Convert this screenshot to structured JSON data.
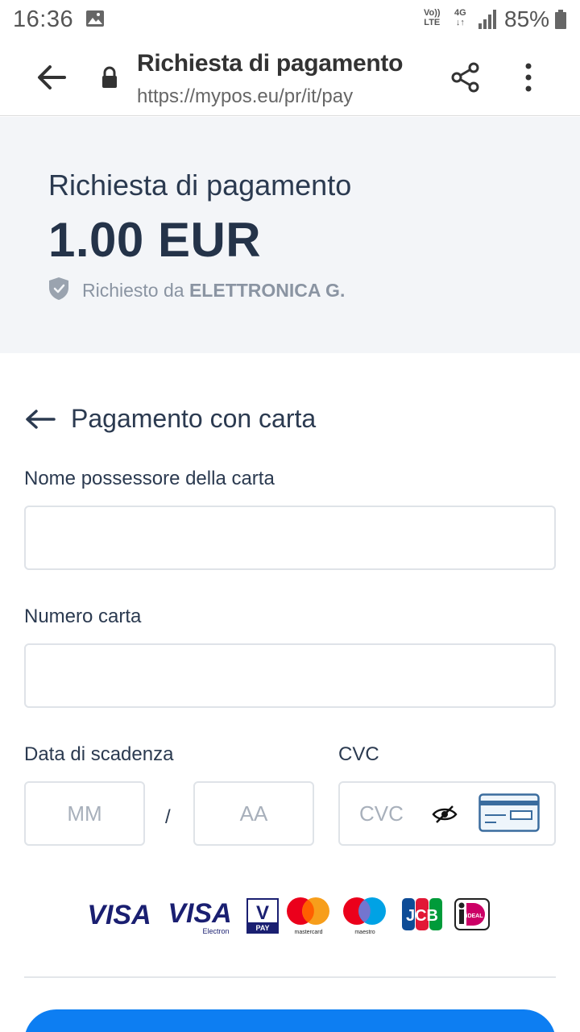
{
  "status_bar": {
    "time": "16:36",
    "volte_line1": "Vo))",
    "volte_line2": "LTE",
    "network": "4G",
    "battery": "85%"
  },
  "browser": {
    "title": "Richiesta di pagamento",
    "url": "https://mypos.eu/pr/it/pay"
  },
  "payment": {
    "title": "Richiesta di pagamento",
    "amount": "1.00 EUR",
    "requested_by_prefix": "Richiesto da ",
    "merchant": "ELETTRONICA G."
  },
  "card_form": {
    "section_title": "Pagamento con carta",
    "cardholder_label": "Nome possessore della carta",
    "cardholder_value": "",
    "card_number_label": "Numero carta",
    "card_number_value": "",
    "expiry_label": "Data di scadenza",
    "month_placeholder": "MM",
    "year_placeholder": "AA",
    "slash": "/",
    "cvc_label": "CVC",
    "cvc_placeholder": "CVC"
  },
  "brands": [
    "VISA",
    "VISA Electron",
    "V PAY",
    "mastercard",
    "maestro",
    "JCB",
    "iDEAL"
  ],
  "brand_text": {
    "visa": "VISA",
    "visa_electron_main": "VISA",
    "visa_electron_sub": "Electron",
    "vpay_v": "V",
    "vpay_pay": "PAY",
    "mastercard": "mastercard",
    "maestro": "maestro",
    "jcb": "JCB",
    "ideal": "iDEAL"
  },
  "colors": {
    "accent": "#0d7ef2",
    "header_bg": "#f3f5f8",
    "text_dark": "#243349",
    "text_muted": "#8a94a2",
    "visa_blue": "#1a1f71"
  }
}
